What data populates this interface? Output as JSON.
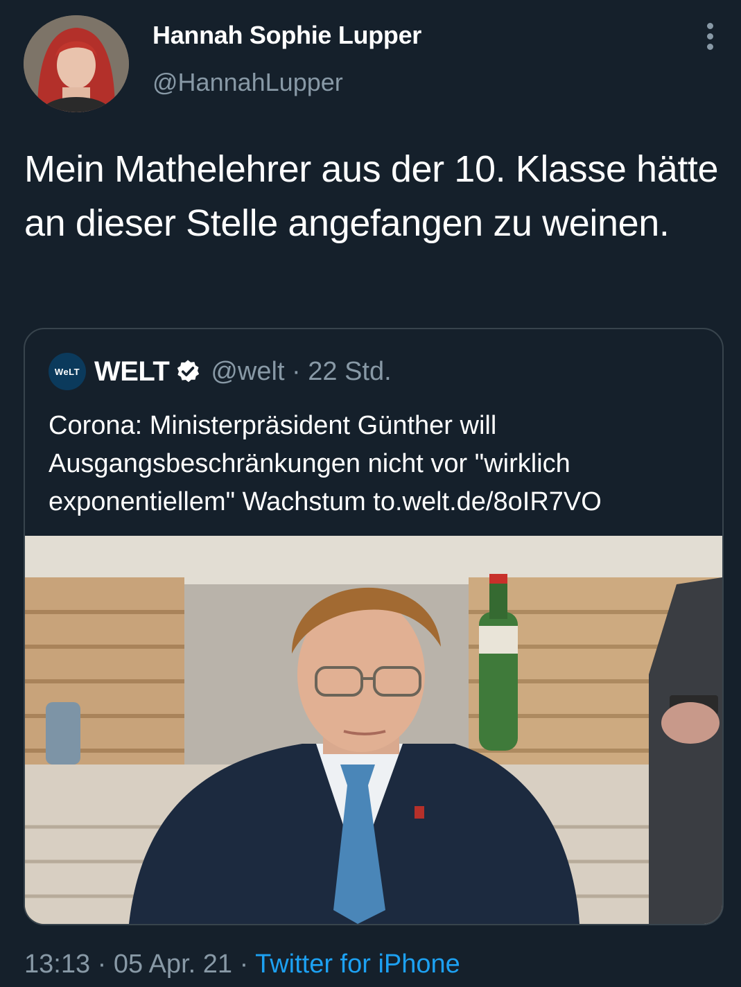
{
  "tweet": {
    "author": {
      "display_name": "Hannah Sophie Lupper",
      "handle": "@HannahLupper"
    },
    "text": "Mein Mathelehrer aus der 10. Klasse hätte an dieser Stelle angefangen zu weinen.",
    "quoted_tweet": {
      "avatar_text": "WeLT",
      "name": "WELT",
      "verified": true,
      "meta": "@welt · 22 Std.",
      "text": "Corona: Ministerpräsident Günther will Ausgangsbeschränkungen nicht vor \"wirklich exponentiellem\" Wachstum to.welt.de/8oIR7VO"
    },
    "footer": {
      "time_date": "13:13 · 05 Apr. 21 · ",
      "source": "Twitter for iPhone"
    }
  },
  "colors": {
    "background": "#15202b",
    "secondary_text": "#8899a6",
    "link": "#1da1f2",
    "border": "#38444d"
  }
}
